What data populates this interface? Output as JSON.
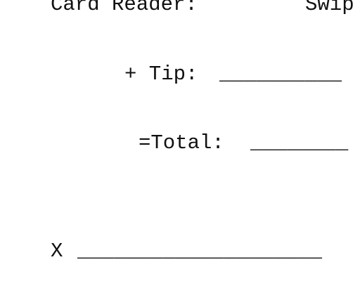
{
  "receipt": {
    "card_reader_label": "Card Reader:",
    "card_reader_value": "Swip",
    "tip_label": "+ Tip:",
    "tip_blank": "__________",
    "total_label": "=Total:",
    "total_blank": "________",
    "signature_mark": "X",
    "signature_blank": "____________________"
  }
}
